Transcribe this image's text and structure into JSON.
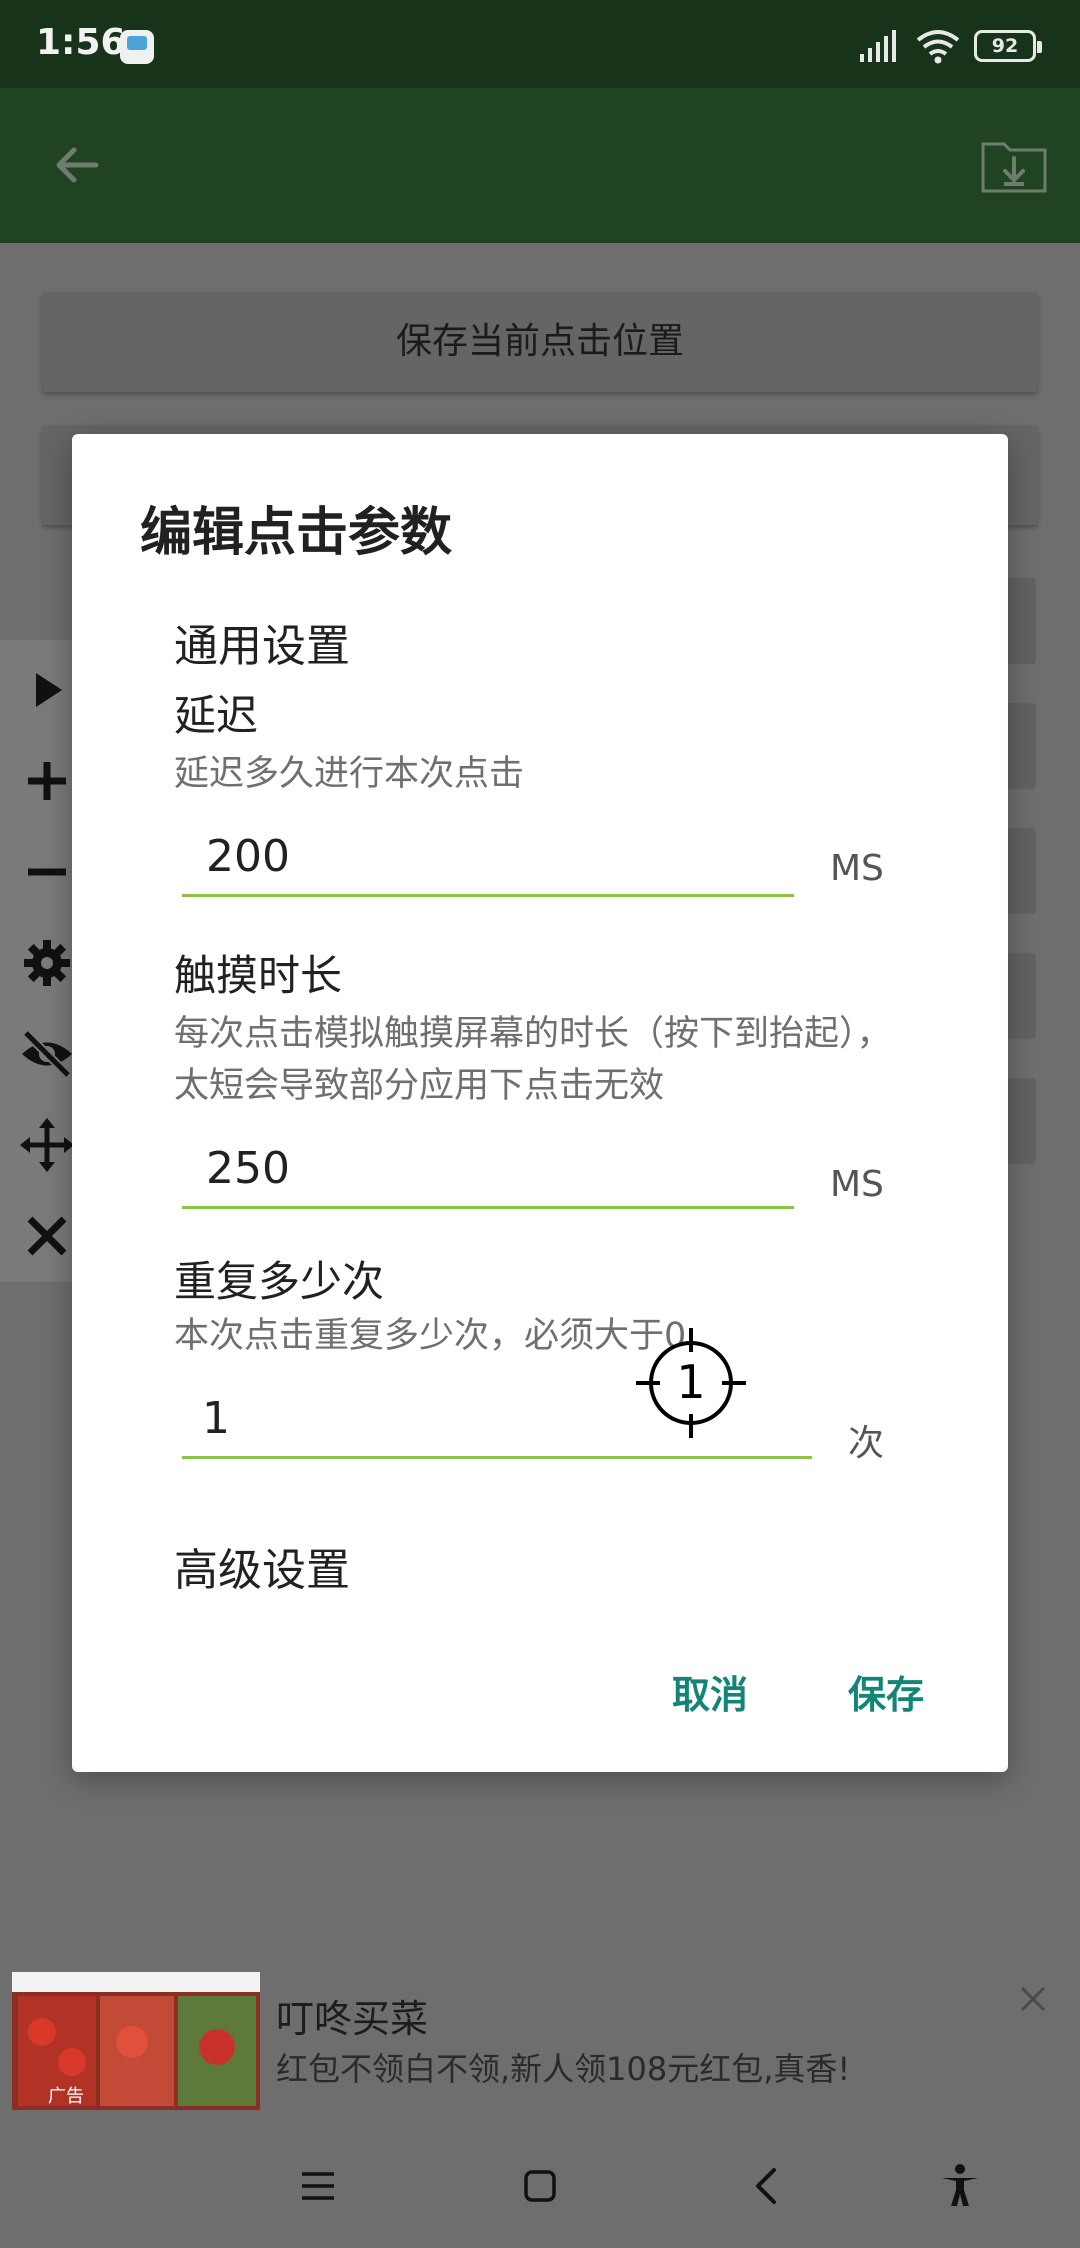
{
  "status_bar": {
    "time": "1:56",
    "battery": "92"
  },
  "app_bar": {
    "back_icon": "arrow-left-icon",
    "action_icon": "folder-download-icon"
  },
  "background": {
    "save_position_label": "保存当前点击位置"
  },
  "toolbar": {
    "icons": [
      "play-icon",
      "plus-icon",
      "minus-icon",
      "gear-icon",
      "eye-off-icon",
      "move-icon",
      "close-icon"
    ]
  },
  "dialog": {
    "title": "编辑点击参数",
    "general_section": "通用设置",
    "delay": {
      "title": "延迟",
      "desc": "延迟多久进行本次点击",
      "value": "200",
      "unit": "MS"
    },
    "touch_duration": {
      "title": "触摸时长",
      "desc": "每次点击模拟触摸屏幕的时长（按下到抬起），太短会导致部分应用下点击无效",
      "value": "250",
      "unit": "MS"
    },
    "repeat": {
      "title": "重复多少次",
      "desc": "本次点击重复多少次，必须大于0",
      "value": "1",
      "unit": "次"
    },
    "advanced_section": "高级设置",
    "cancel_label": "取消",
    "save_label": "保存"
  },
  "crosshair": {
    "label": "1"
  },
  "ad": {
    "title": "叮咚买菜",
    "desc": "红包不领白不领,新人领108元红包,真香!",
    "badge": "广告"
  },
  "navbar": {
    "icons": [
      "menu-icon",
      "home-square-icon",
      "back-chevron-icon",
      "accessibility-icon"
    ]
  },
  "colors": {
    "accent": "#138577",
    "field_underline": "#8bc34a",
    "app_bar": "#204422",
    "status_bar": "#173319"
  }
}
